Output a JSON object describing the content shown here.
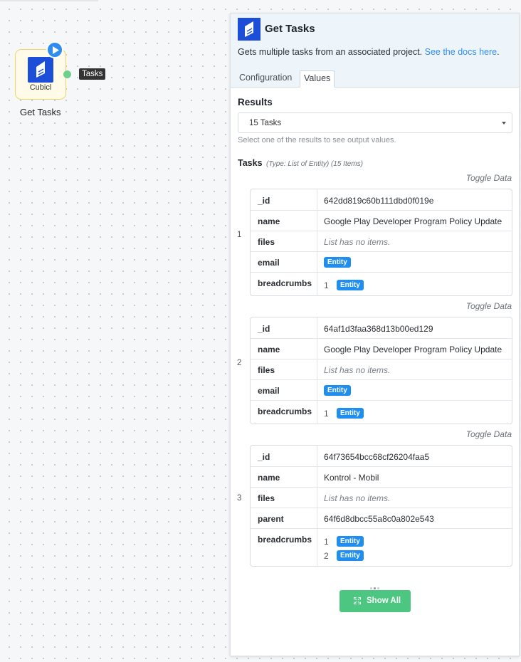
{
  "canvas": {
    "node": {
      "app_name": "Cubicl",
      "label": "Get Tasks",
      "output_label": "Tasks"
    }
  },
  "panel": {
    "title": "Get Tasks",
    "description": "Gets multiple tasks from an associated project.",
    "docs_link": "See the docs here",
    "description_end": ".",
    "tabs": {
      "configuration": "Configuration",
      "values": "Values"
    },
    "results_label": "Results",
    "results_selected": "15 Tasks",
    "results_hint": "Select one of the results to see output values.",
    "tasks_title": "Tasks",
    "tasks_meta": "(Type: List of Entity) (15 Items)",
    "toggle_label": "Toggle Data",
    "show_all_label": "Show All",
    "entity_badge": "Entity",
    "empty_list": "List has no items.",
    "items": [
      {
        "index": "1",
        "rows": [
          {
            "key": "_id",
            "value": "642dd819c60b111dbd0f019e"
          },
          {
            "key": "name",
            "value": "Google Play Developer Program Policy Update"
          },
          {
            "key": "files"
          },
          {
            "key": "email"
          },
          {
            "key": "breadcrumbs",
            "list_index": [
              "1"
            ]
          }
        ]
      },
      {
        "index": "2",
        "rows": [
          {
            "key": "_id",
            "value": "64af1d3faa368d13b00ed129"
          },
          {
            "key": "name",
            "value": "Google Play Developer Program Policy Update"
          },
          {
            "key": "files"
          },
          {
            "key": "email"
          },
          {
            "key": "breadcrumbs",
            "list_index": [
              "1"
            ]
          }
        ]
      },
      {
        "index": "3",
        "rows": [
          {
            "key": "_id",
            "value": "64f73654bcc68cf26204faa5"
          },
          {
            "key": "name",
            "value": "Kontrol - Mobil"
          },
          {
            "key": "files"
          },
          {
            "key": "parent",
            "value": "64f6d8dbcc55a8c0a802e543"
          },
          {
            "key": "breadcrumbs",
            "list_index": [
              "1",
              "2"
            ]
          }
        ]
      }
    ]
  }
}
